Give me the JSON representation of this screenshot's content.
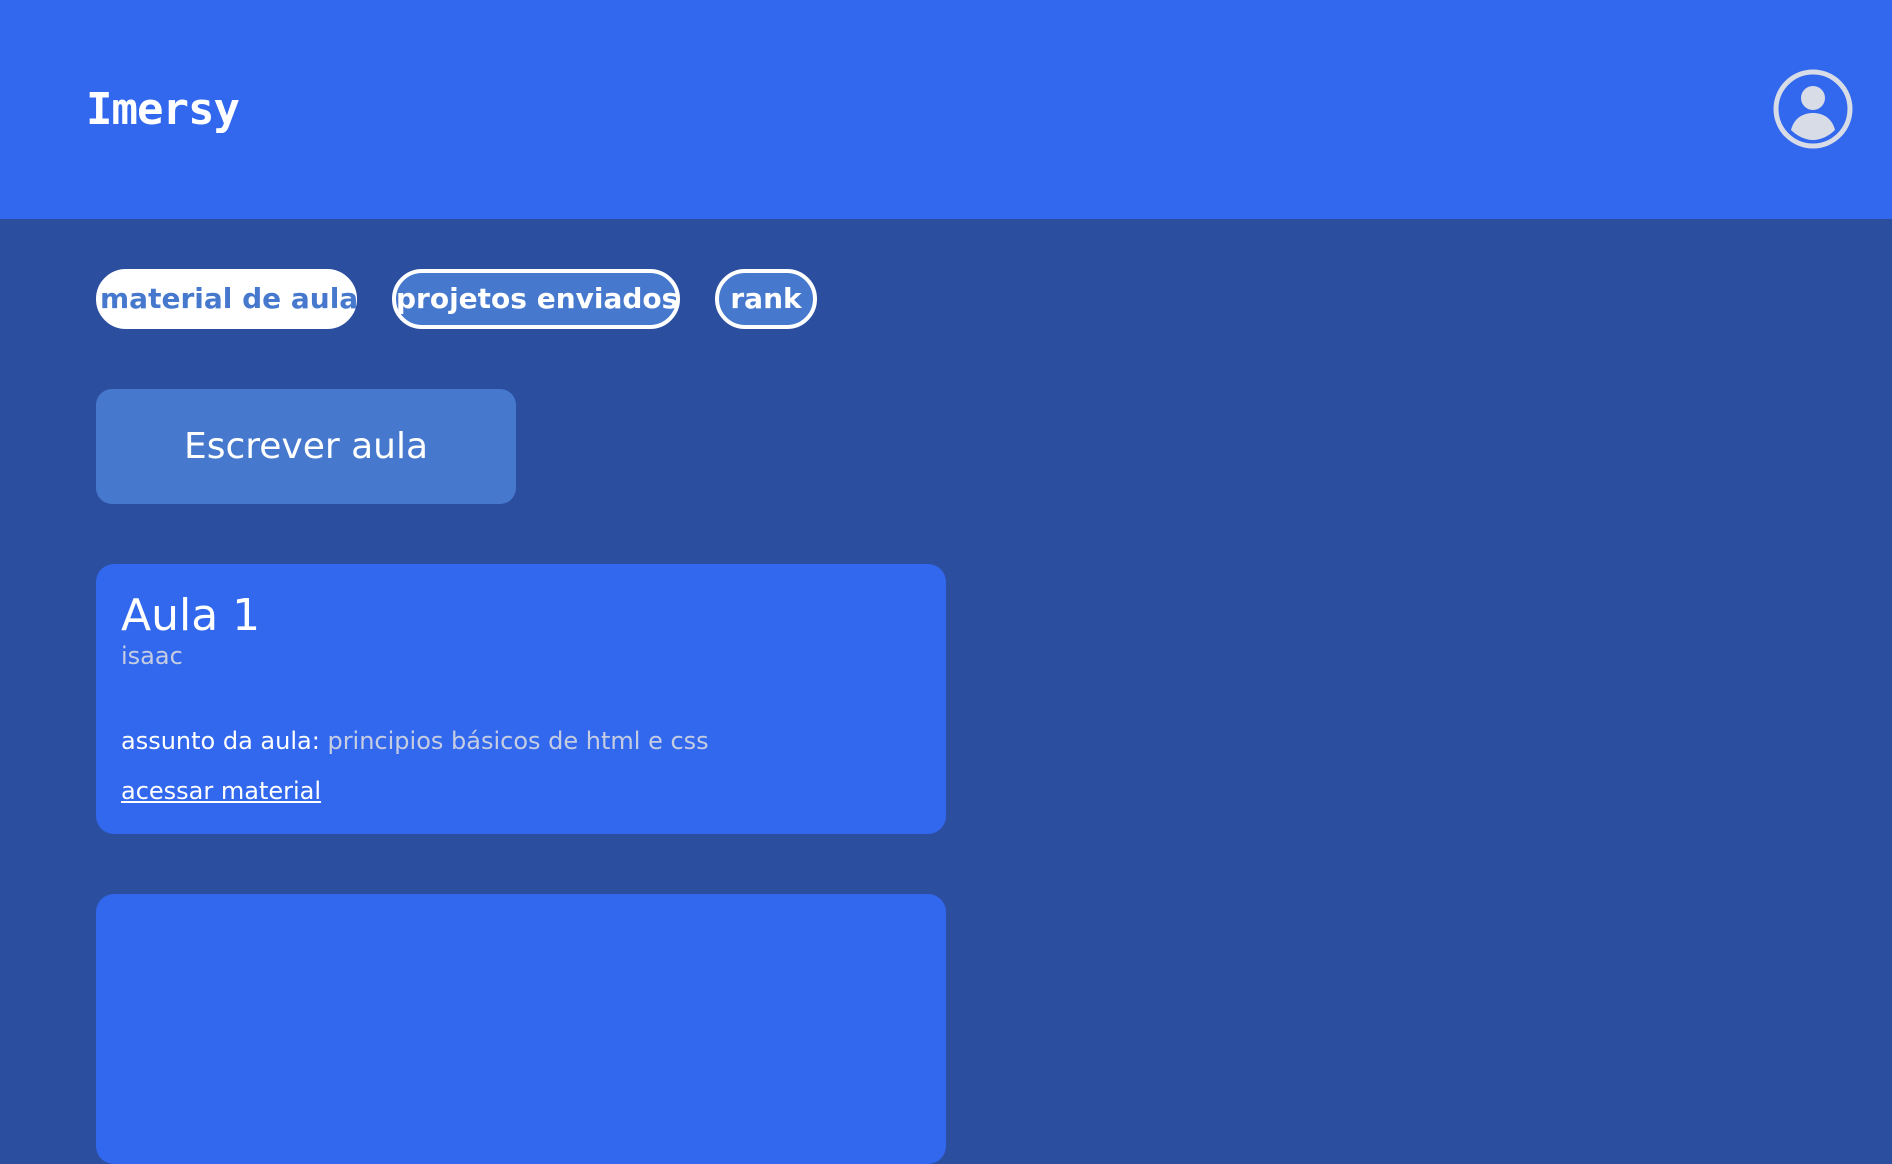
{
  "header": {
    "logo": "Imersy",
    "avatar_icon": "user-circle-icon"
  },
  "tabs": [
    {
      "label": "material de aula",
      "active": true
    },
    {
      "label": "projetos enviados",
      "active": false
    },
    {
      "label": "rank",
      "active": false
    }
  ],
  "write_button": {
    "label": "Escrever aula"
  },
  "lessons": [
    {
      "title": "Aula 1",
      "author": "isaac",
      "subject_label": "assunto da aula:",
      "subject": "principios básicos de html e css",
      "link": "acessar material"
    }
  ],
  "colors": {
    "header_bg": "#3168ee",
    "page_bg": "#2c4e9f",
    "accent": "#4679ce",
    "card_bg": "#3168ee",
    "muted_text": "#c6cde2"
  }
}
